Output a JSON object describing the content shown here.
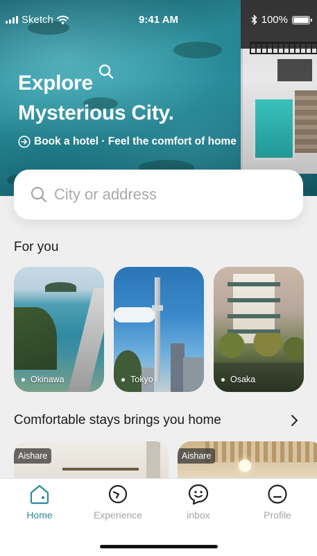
{
  "status_bar": {
    "carrier": "Sketch",
    "time": "9:41 AM",
    "battery": "100%"
  },
  "hero": {
    "title_line1": "Explore",
    "title_line2": "Mysterious City.",
    "tagline": "Book a hotel · Feel the comfort of home"
  },
  "search": {
    "placeholder": "City or address",
    "value": ""
  },
  "for_you": {
    "title": "For you",
    "cards": [
      {
        "label": "Okinawa"
      },
      {
        "label": "Tokyo"
      },
      {
        "label": "Osaka"
      }
    ]
  },
  "stays": {
    "title": "Comfortable stays brings you home",
    "items": [
      {
        "tag": "Aishare"
      },
      {
        "tag": "Aishare"
      }
    ]
  },
  "tabbar": {
    "tabs": [
      {
        "label": "Home",
        "icon": "home-icon",
        "active": true
      },
      {
        "label": "Experience",
        "icon": "compass-icon",
        "active": false
      },
      {
        "label": "inbox",
        "icon": "chat-icon",
        "active": false
      },
      {
        "label": "Profile",
        "icon": "profile-icon",
        "active": false
      }
    ]
  },
  "colors": {
    "accent": "#2a8c94",
    "inactive": "#a4a4a4",
    "background": "#efefef"
  }
}
